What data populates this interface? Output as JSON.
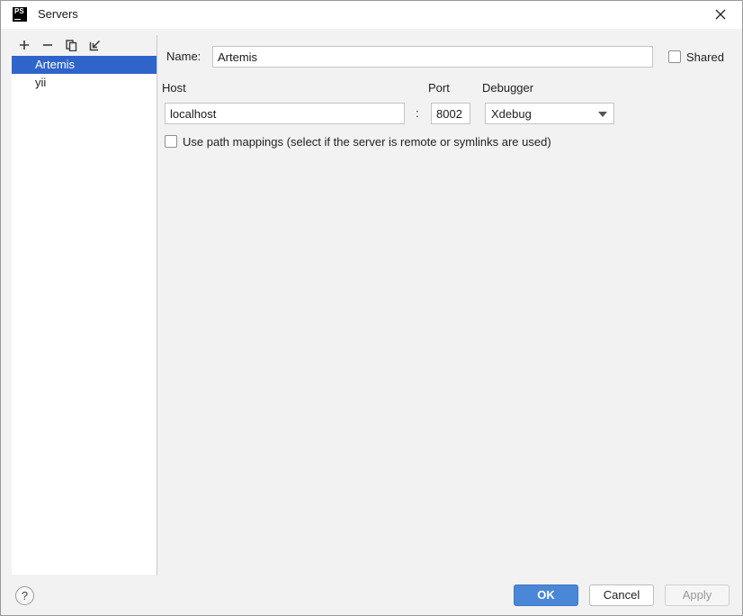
{
  "window": {
    "title": "Servers",
    "app_logo_text": "PS"
  },
  "toolbar": {
    "icons": [
      "add-icon",
      "remove-icon",
      "copy-icon",
      "import-icon"
    ]
  },
  "servers": [
    {
      "name": "Artemis",
      "selected": true
    },
    {
      "name": "yii",
      "selected": false
    }
  ],
  "form": {
    "name_label": "Name:",
    "name_value": "Artemis",
    "shared_label": "Shared",
    "shared_checked": false,
    "host_label": "Host",
    "host_value": "localhost",
    "colon": ":",
    "port_label": "Port",
    "port_value": "8002",
    "debugger_label": "Debugger",
    "debugger_value": "Xdebug",
    "path_mappings_label": "Use path mappings (select if the server is remote or symlinks are used)",
    "path_mappings_checked": false
  },
  "footer": {
    "help_label": "?",
    "ok_label": "OK",
    "cancel_label": "Cancel",
    "apply_label": "Apply"
  },
  "colors": {
    "selection": "#2f65ca",
    "primary_button": "#4a87d6",
    "background": "#f2f2f2"
  }
}
